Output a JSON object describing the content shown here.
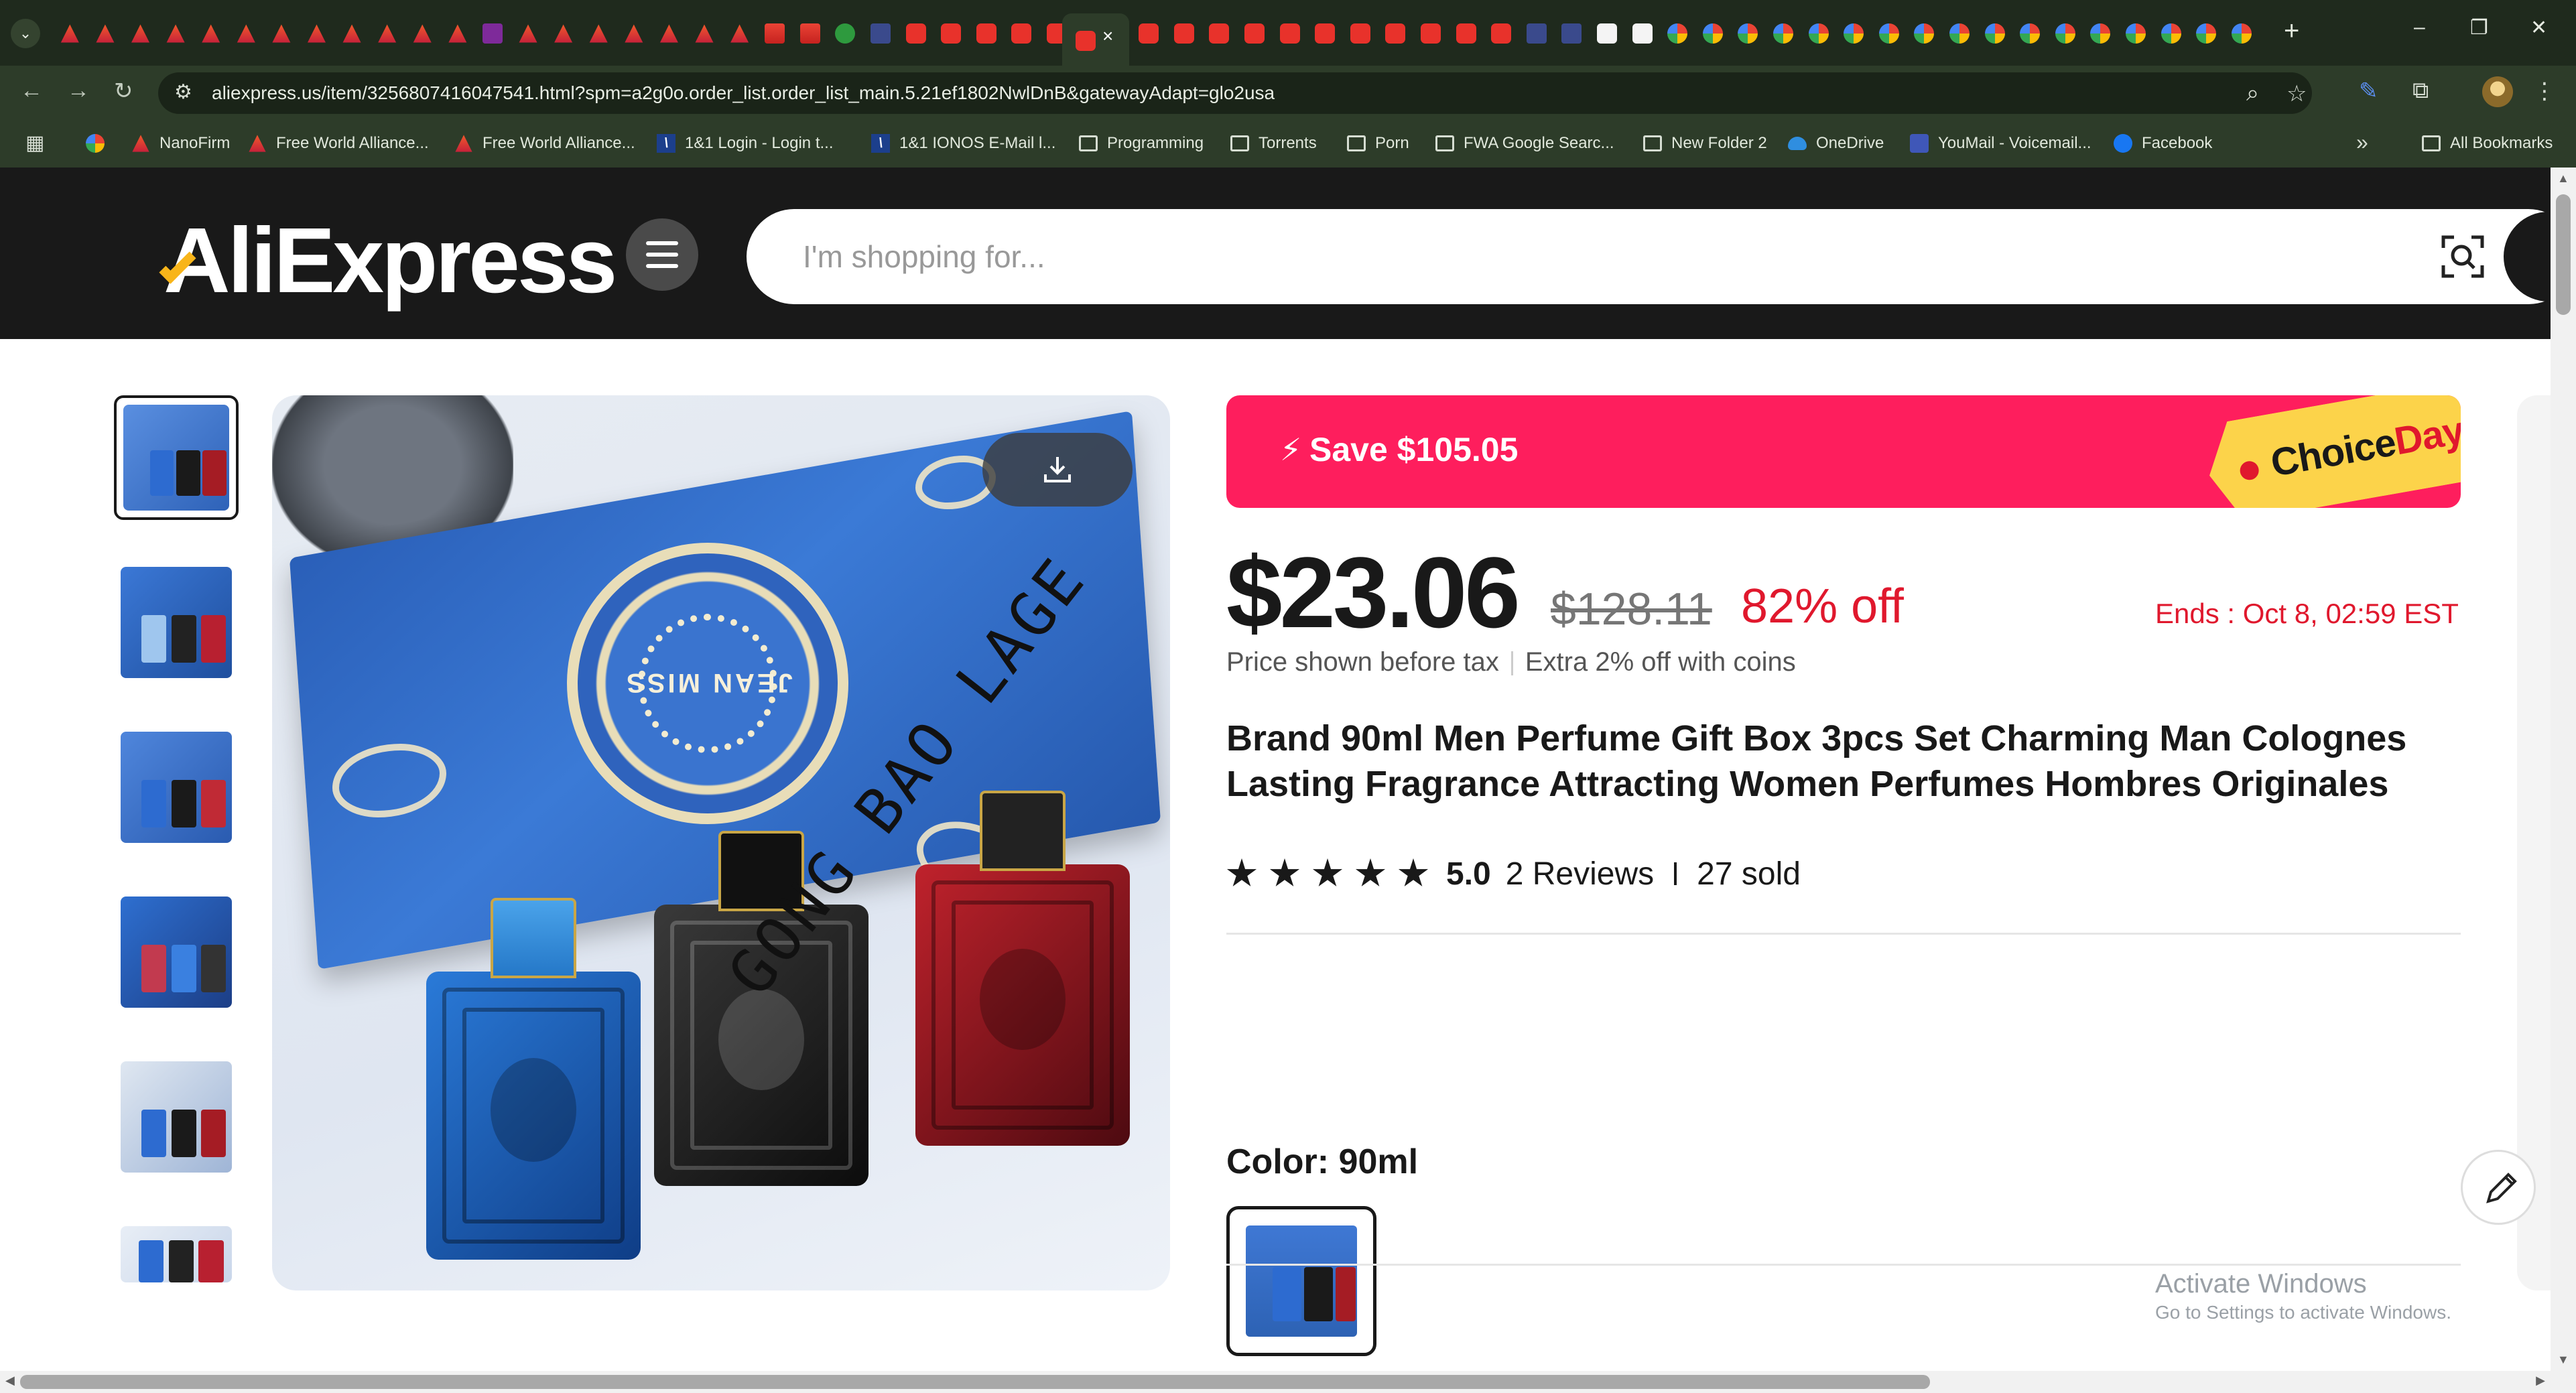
{
  "browser": {
    "tab_list_icon": "chevron-down-icon",
    "tab_favicons": [
      "ae",
      "ae",
      "ae",
      "ae",
      "ae",
      "ae",
      "ae",
      "ae",
      "ae",
      "ae",
      "ae",
      "ae",
      "pr",
      "ae",
      "ae",
      "ae",
      "ae",
      "ae",
      "ae",
      "ae",
      "gm",
      "gm",
      "gr",
      "dk",
      "tm",
      "tm",
      "tm",
      "tm",
      "tm"
    ],
    "tab_favicons_right": [
      "tm",
      "tm",
      "tm",
      "tm",
      "tm",
      "tm",
      "tm",
      "tm",
      "tm",
      "tm",
      "tm",
      "dk",
      "dk",
      "az",
      "az",
      "go",
      "go",
      "go",
      "go",
      "go",
      "go",
      "go",
      "go",
      "go",
      "go",
      "go",
      "go",
      "go",
      "go",
      "go",
      "go",
      "go"
    ],
    "active_tab_close": "×",
    "new_tab": "+",
    "window_controls": [
      "–",
      "❐",
      "✕"
    ],
    "url": "aliexpress.us/item/3256807416047541.html?spm=a2g0o.order_list.order_list_main.5.21ef1802NwlDnB&gatewayAdapt=glo2usa",
    "nav": {
      "back": "←",
      "forward": "→",
      "reload": "↻"
    },
    "bookmarks": [
      {
        "label": "NanoFirm",
        "icon": "ae"
      },
      {
        "label": "Free World Alliance...",
        "icon": "ae"
      },
      {
        "label": "Free World Alliance...",
        "icon": "ae"
      },
      {
        "label": "1&1 Login - Login t...",
        "icon": "ion"
      },
      {
        "label": "1&1 IONOS E-Mail l...",
        "icon": "ion"
      },
      {
        "label": "Programming",
        "icon": "fold"
      },
      {
        "label": "Torrents",
        "icon": "fold"
      },
      {
        "label": "Porn",
        "icon": "fold"
      },
      {
        "label": "FWA Google Searc...",
        "icon": "fold"
      },
      {
        "label": "New Folder 2",
        "icon": "fold"
      },
      {
        "label": "OneDrive",
        "icon": "od"
      },
      {
        "label": "YouMail - Voicemail...",
        "icon": "ym"
      },
      {
        "label": "Facebook",
        "icon": "fb"
      }
    ],
    "all_bookmarks": "All Bookmarks",
    "more_bookmarks": "»"
  },
  "header": {
    "logo": "AliExpress",
    "search_placeholder": "I'm shopping for..."
  },
  "product": {
    "thumbnails": 6,
    "image_watermark": "GONG BAO LAGE",
    "box_brand": "JEAN MISS",
    "promo": {
      "save_text": "Save $105.05",
      "badge_choice": "Choice",
      "badge_day": "Day"
    },
    "price_now": "$23.06",
    "price_was": "$128.11",
    "discount": "82% off",
    "ends": "Ends :  Oct 8, 02:59 EST",
    "tax_note": "Price shown before tax",
    "coins_note": "Extra 2% off with coins",
    "title": "Brand 90ml Men Perfume Gift Box 3pcs Set Charming Man Colognes Lasting Fragrance Attracting Women Perfumes Hombres Originales",
    "rating": {
      "stars": 5,
      "score": "5.0",
      "reviews": "2 Reviews",
      "sold": "27 sold"
    },
    "color_label": "Color: 90ml"
  },
  "overlay": {
    "activate_title": "Activate Windows",
    "activate_sub": "Go to Settings to activate Windows."
  },
  "colors": {
    "brand_dark": "#191919",
    "promo_red": "#fe1e5d",
    "choice_yellow": "#fcd34a",
    "price_red": "#e0182d",
    "chrome_green": "#2d3c29"
  }
}
